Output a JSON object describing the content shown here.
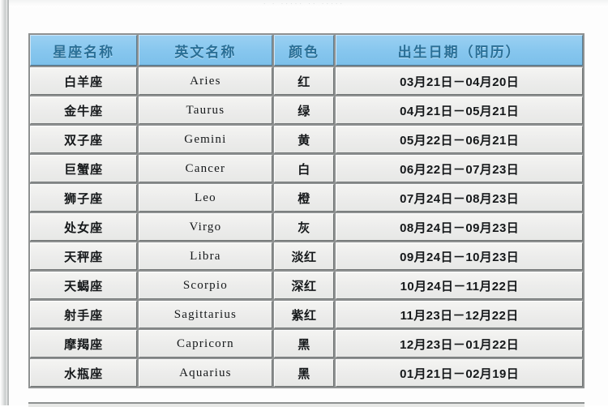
{
  "page": {
    "top_artifact_text": "· · ·····  ··  ·····"
  },
  "table": {
    "columns": [
      {
        "key": "cn_name",
        "label": "星座名称"
      },
      {
        "key": "en_name",
        "label": "英文名称"
      },
      {
        "key": "color",
        "label": "颜色"
      },
      {
        "key": "date",
        "label": "出生日期（阳历）"
      }
    ],
    "rows": [
      {
        "cn_name": "白羊座",
        "en_name": "Aries",
        "color": "红",
        "date": "03月21日－04月20日"
      },
      {
        "cn_name": "金牛座",
        "en_name": "Taurus",
        "color": "绿",
        "date": "04月21日－05月21日"
      },
      {
        "cn_name": "双子座",
        "en_name": "Gemini",
        "color": "黄",
        "date": "05月22日－06月21日"
      },
      {
        "cn_name": "巨蟹座",
        "en_name": "Cancer",
        "color": "白",
        "date": "06月22日－07月23日"
      },
      {
        "cn_name": "狮子座",
        "en_name": "Leo",
        "color": "橙",
        "date": "07月24日－08月23日"
      },
      {
        "cn_name": "处女座",
        "en_name": "Virgo",
        "color": "灰",
        "date": "08月24日－09月23日"
      },
      {
        "cn_name": "天秤座",
        "en_name": "Libra",
        "color": "淡红",
        "date": "09月24日－10月23日"
      },
      {
        "cn_name": "天蝎座",
        "en_name": "Scorpio",
        "color": "深红",
        "date": "10月24日－11月22日"
      },
      {
        "cn_name": "射手座",
        "en_name": "Sagittarius",
        "color": "紫红",
        "date": "11月23日－12月22日"
      },
      {
        "cn_name": "摩羯座",
        "en_name": "Capricorn",
        "color": "黑",
        "date": "12月23日－01月22日"
      },
      {
        "cn_name": "水瓶座",
        "en_name": "Aquarius",
        "color": "黑",
        "date": "01月21日－02月19日"
      }
    ]
  },
  "colors": {
    "header_blue": "#86c6ee",
    "header_text": "#2a6f96",
    "cell_fill": "#ececeb",
    "grid_line": "#8e9191",
    "paper": "#fdfdfd"
  }
}
